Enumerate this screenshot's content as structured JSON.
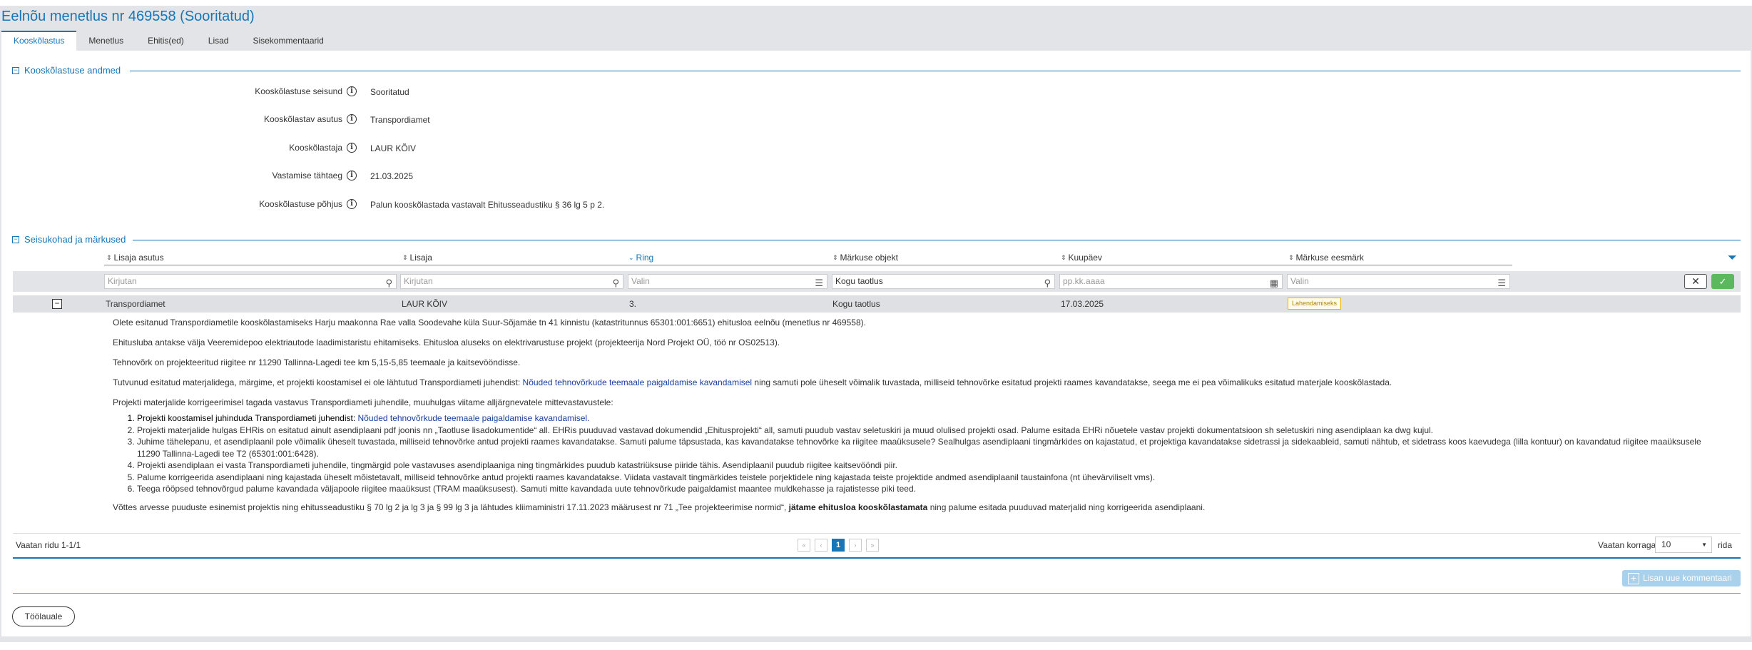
{
  "page": {
    "title": "Eelnõu menetlus nr 469558 (Sooritatud)",
    "tabs": [
      "Kooskõlastus",
      "Menetlus",
      "Ehitis(ed)",
      "Lisad",
      "Sisekommentaarid"
    ],
    "active_tab": "Kooskõlastus"
  },
  "details": {
    "section_title": "Kooskõlastuse andmed",
    "fields": [
      {
        "label": "Kooskõlastuse seisund",
        "value": "Sooritatud"
      },
      {
        "label": "Kooskõlastav asutus",
        "value": "Transpordiamet"
      },
      {
        "label": "Kooskõlastaja",
        "value": "LAUR KÕIV"
      },
      {
        "label": "Vastamise tähtaeg",
        "value": "21.03.2025"
      },
      {
        "label": "Kooskõlastuse põhjus",
        "value": "Palun kooskõlastada vastavalt Ehitusseadustiku § 36 lg 5 p 2."
      }
    ]
  },
  "remarks": {
    "section_title": "Seisukohad ja märkused",
    "columns": [
      "Lisaja asutus",
      "Lisaja",
      "Ring",
      "Märkuse objekt",
      "Kuupäev",
      "Märkuse eesmärk"
    ],
    "sorted_column": "Ring",
    "filters": [
      {
        "value": "",
        "placeholder": "Kirjutan",
        "icon": "search-icon"
      },
      {
        "value": "",
        "placeholder": "Kirjutan",
        "icon": "search-icon"
      },
      {
        "value": "",
        "placeholder": "Valin",
        "icon": "list-icon"
      },
      {
        "value": "Kogu taotlus",
        "placeholder": "",
        "icon": "search-icon"
      },
      {
        "value": "",
        "placeholder": "pp.kk.aaaa",
        "icon": "calendar-icon"
      },
      {
        "value": "",
        "placeholder": "Valin",
        "icon": "list-icon"
      }
    ],
    "row": {
      "asutus": "Transpordiamet",
      "lisaja": "LAUR KÕIV",
      "ring": "3.",
      "objekt": "Kogu taotlus",
      "kuupaev": "17.03.2025",
      "eesmark": "Lahendamiseks"
    },
    "comment": {
      "p1": "Olete esitanud Transpordiametile kooskõlastamiseks Harju maakonna Rae valla Soodevahe küla Suur-Sõjamäe tn 41 kinnistu (katastritunnus 65301:001:6651) ehitusloa eelnõu (menetlus nr 469558).",
      "p2": "Ehitusluba antakse välja Veeremidepoo elektriautode laadimistaristu ehitamiseks. Ehitusloa aluseks on elektrivarustuse projekt (projekteerija Nord Projekt OÜ, töö nr OS02513).",
      "p3": "Tehnovõrk on projekteeritud riigitee nr 11290 Tallinna-Lagedi tee km 5,15-5,85 teemaale ja kaitsevööndisse.",
      "p4_a": "Tutvunud esitatud materjalidega, märgime, et ",
      "p4_b": "projekti koostamisel ei ole lähtutud Transpordiameti juhendist: ",
      "p4_link": "Nõuded tehnovõrkude teemaale paigaldamise kavandamisel",
      "p4_c": " ning samuti pole üheselt võimalik tuvastada, milliseid tehnovõrke esitatud projekti raames kavandatakse, seega me ei pea võimalikuks esitatud materjale kooskõlastada.",
      "p5": "Projekti materjalide korrigeerimisel tagada vastavus Transpordiameti juhendile, muuhulgas viitame alljärgnevatele mittevastavustele:",
      "li1_a": "Projekti koostamisel juhinduda Transpordiameti juhendist: ",
      "li1_link": "Nõuded tehnovõrkude teemaale paigaldamise kavandamisel.",
      "li2": "Projekti materjalide hulgas EHRis on esitatud ainult asendiplaani pdf joonis nn „Taotluse lisadokumentide“ all. EHRis puuduvad vastavad dokumendid „Ehitusprojekti“ all, samuti puudub vastav seletuskiri ja muud olulised projekti osad. Palume esitada EHRi nõuetele vastav projekti dokumentatsioon sh seletuskiri ning asendiplaan ka dwg kujul.",
      "li3": "Juhime tähelepanu, et asendiplaanil pole võimalik üheselt tuvastada, milliseid tehnovõrke antud projekti raames kavandatakse. Samuti palume täpsustada, kas kavandatakse tehnovõrke ka riigitee maaüksusele? Sealhulgas asendiplaani tingmärkides on kajastatud, et projektiga kavandatakse sidetrassi ja sidekaableid, samuti nähtub, et sidetrass koos kaevudega (lilla kontuur) on kavandatud riigitee maaüksusele 11290 Tallinna-Lagedi tee T2 (65301:001:6428).",
      "li4": "Projekti asendiplaan ei vasta Transpordiameti juhendile, tingmärgid pole vastavuses asendiplaaniga ning tingmärkides puudub katastriüksuse piiride tähis. Asendiplaanil puudub riigitee kaitsevööndi piir.",
      "li5": "Palume korrigeerida asendiplaani ning kajastada üheselt mõistetavalt, milliseid tehnovõrke antud projekti raames kavandatakse. Viidata vastavalt tingmärkides teistele porjektidele ning kajastada teiste projektide andmed asendiplaanil taustainfona (nt ühevärviliselt vms).",
      "li6": "Teega rööpsed tehnovõrgud palume kavandada väljapoole riigitee maaüksust (TRAM maaüksusest). Samuti mitte kavandada uute tehnovõrkude paigaldamist maantee muldkehasse ja rajatistesse piki teed.",
      "p6_a": "Võttes arvesse puuduste esinemist projektis ning ehitusseadustiku § 70 lg 2 ja lg 3 ja § 99 lg 3 ja lähtudes kliimaministri 17.11.2023 määrusest nr 71 „Tee projekteerimise normid“, ",
      "p6_b": "jätame ehitusloa kooskõlastamata",
      "p6_c": " ning palume esitada puuduvad materjalid ning korrigeerida asendiplaani."
    },
    "pager": {
      "info": "Vaatan ridu 1-1/1",
      "current_page": "1",
      "first": "«",
      "prev": "‹",
      "next": "›",
      "last": "»",
      "per_page_label": "Vaatan korraga",
      "per_page_value": "10",
      "per_page_suffix": "rida"
    },
    "add_comment_label": "Lisan uue kommentaari"
  },
  "footer": {
    "back_label": "Töölauale"
  },
  "colors": {
    "accent": "#1776b6",
    "badge_border": "#f0b400",
    "ok_button": "#5cb85c"
  }
}
